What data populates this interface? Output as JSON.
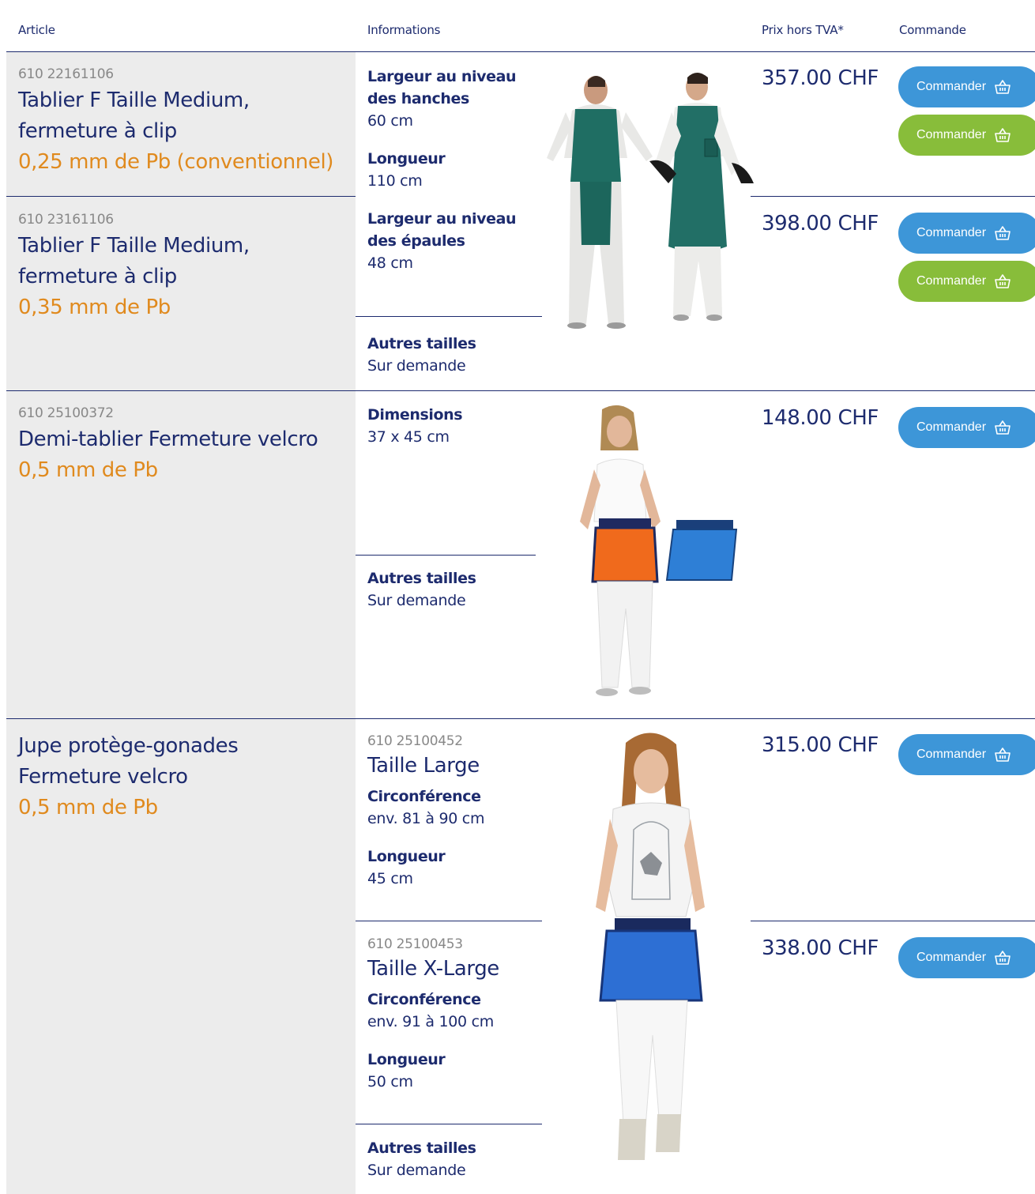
{
  "header": {
    "col_article": "Article",
    "col_info": "Informations",
    "col_price": "Prix hors TVA*",
    "col_order": "Commande"
  },
  "order_label": "Commander",
  "colors": {
    "navy": "#1d2b6e",
    "orange": "#e08a1e",
    "blue_button": "#3d96d8",
    "green_button": "#88bd3a",
    "left_bg": "#ececec"
  },
  "icons": {
    "cart": "basket-icon"
  },
  "group1": {
    "item1": {
      "number": "610 22161106",
      "name_line1": "Tablier F Taille Medium,",
      "name_line2": "fermeture à clip",
      "pb": "0,25 mm de Pb (conventionnel)",
      "price": "357.00 CHF"
    },
    "item2": {
      "number": "610 23161106",
      "name_line1": "Tablier F Taille Medium,",
      "name_line2": "fermeture à clip",
      "pb": "0,35 mm de Pb",
      "price": "398.00 CHF"
    },
    "info": {
      "hip_label_1": "Largeur au niveau",
      "hip_label_2": "des hanches",
      "hip_value": "60 cm",
      "length_label": "Longueur",
      "length_value": "110 cm",
      "shoulder_label_1": "Largeur au niveau",
      "shoulder_label_2": "des épaules",
      "shoulder_value": "48 cm",
      "other_label": "Autres tailles",
      "other_value": "Sur demande"
    }
  },
  "group2": {
    "number": "610 25100372",
    "name": "Demi-tablier Fermeture velcro",
    "pb": "0,5 mm de Pb",
    "price": "148.00 CHF",
    "info": {
      "dim_label": "Dimensions",
      "dim_value": "37 x 45 cm",
      "other_label": "Autres tailles",
      "other_value": "Sur demande"
    }
  },
  "group3": {
    "name_line1": "Jupe protège-gonades",
    "name_line2": "Fermeture velcro",
    "pb": "0,5 mm de Pb",
    "large": {
      "number": "610 25100452",
      "size": "Taille Large",
      "circ_label": "Circonférence",
      "circ_value": "env. 81 à 90 cm",
      "length_label": "Longueur",
      "length_value": "45 cm",
      "price": "315.00 CHF"
    },
    "xlarge": {
      "number": "610 25100453",
      "size": "Taille X-Large",
      "circ_label": "Circonférence",
      "circ_value": "env. 91 à 100 cm",
      "length_label": "Longueur",
      "length_value": "50 cm",
      "price": "338.00 CHF"
    },
    "other_label": "Autres tailles",
    "other_value": "Sur demande"
  }
}
